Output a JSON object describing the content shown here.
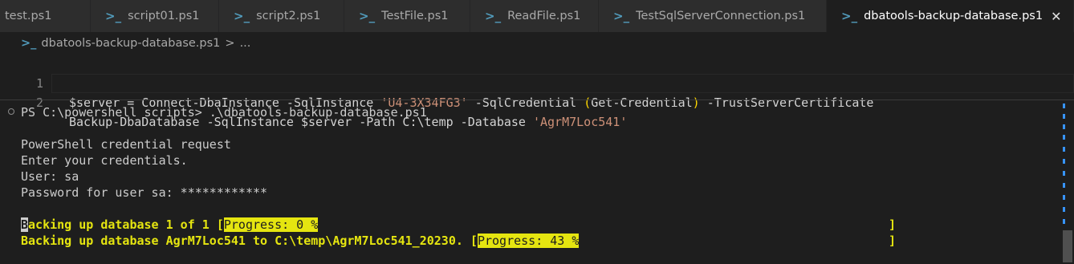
{
  "tabs": [
    {
      "label": "test.ps1",
      "icon": "powershell-icon"
    },
    {
      "label": "script01.ps1",
      "icon": "powershell-icon"
    },
    {
      "label": "script2.ps1",
      "icon": "powershell-icon"
    },
    {
      "label": "TestFile.ps1",
      "icon": "powershell-icon"
    },
    {
      "label": "ReadFile.ps1",
      "icon": "powershell-icon"
    },
    {
      "label": "TestSqlServerConnection.ps1",
      "icon": "powershell-icon"
    },
    {
      "label": "dbatools-backup-database.ps1",
      "icon": "powershell-icon",
      "active": true,
      "close_glyph": "✕"
    }
  ],
  "breadcrumb": {
    "file": "dbatools-backup-database.ps1",
    "separator": ">",
    "rest": "..."
  },
  "editor": {
    "lines": [
      {
        "number": "1",
        "parts": [
          {
            "text": "$server = Connect-DbaInstance -SqlInstance ",
            "kind": "plain"
          },
          {
            "text": "'U4-3X34FG3'",
            "kind": "string"
          },
          {
            "text": " -SqlCredential ",
            "kind": "plain"
          },
          {
            "text": "(",
            "kind": "paren"
          },
          {
            "text": "Get-Credential",
            "kind": "plain"
          },
          {
            "text": ")",
            "kind": "paren"
          },
          {
            "text": " -TrustServerCertificate",
            "kind": "plain"
          }
        ]
      },
      {
        "number": "2",
        "parts": [
          {
            "text": "Backup-DbaDatabase -SqlInstance $server -Path C:\\temp -Database ",
            "kind": "plain"
          },
          {
            "text": "'AgrM7Loc541'",
            "kind": "string"
          }
        ]
      }
    ]
  },
  "terminal": {
    "prompt": "PS C:\\powershell scripts> .\\dbatools-backup-database.ps1",
    "cred_title": "PowerShell credential request",
    "cred_msg": "Enter your credentials.",
    "user": "User: sa",
    "password": "Password for user sa: ************",
    "progress1": {
      "cursor_char": "B",
      "prefix": "acking up database 1 of 1 [",
      "bar_text": "Progress: 0 %",
      "end": "]",
      "percent": 0
    },
    "progress2": {
      "prefix": "Backing up database AgrM7Loc541 to C:\\temp\\AgrM7Loc541_20230. [",
      "bar_text": "Progress: 43 %",
      "end": "]",
      "percent": 43
    }
  },
  "colors": {
    "accent": "#3794ff",
    "progress_yellow": "#e5e510",
    "string": "#ce9178",
    "powershell_icon": "#519aba"
  }
}
